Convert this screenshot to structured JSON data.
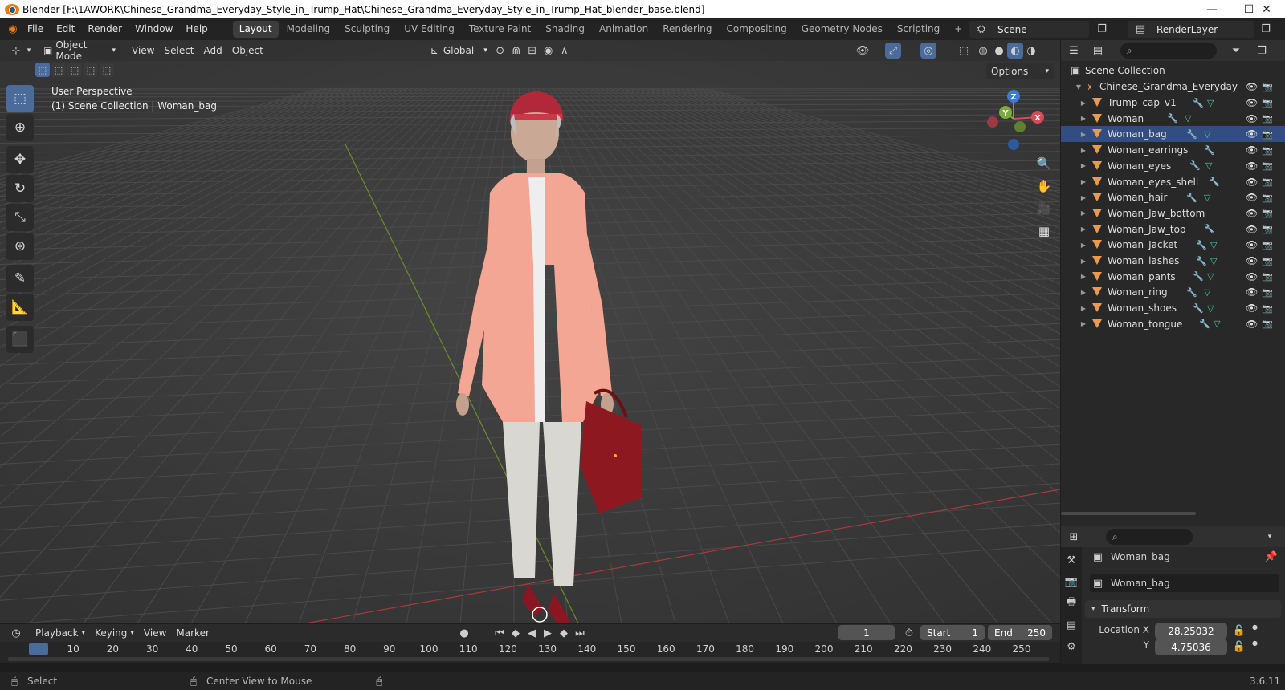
{
  "titlebar": {
    "title": "Blender [F:\\1AWORK\\Chinese_Grandma_Everyday_Style_in_Trump_Hat\\Chinese_Grandma_Everyday_Style_in_Trump_Hat_blender_base.blend]",
    "minimize": "—",
    "maximize": "☐",
    "close": "✕"
  },
  "menu": {
    "items": [
      "File",
      "Edit",
      "Render",
      "Window",
      "Help"
    ]
  },
  "workspaces": {
    "tabs": [
      "Layout",
      "Modeling",
      "Sculpting",
      "UV Editing",
      "Texture Paint",
      "Shading",
      "Animation",
      "Rendering",
      "Compositing",
      "Geometry Nodes",
      "Scripting"
    ],
    "active": "Layout",
    "add": "+"
  },
  "scene": {
    "label": "Scene",
    "render_layer": "RenderLayer"
  },
  "viewport": {
    "mode": "Object Mode",
    "menus": [
      "View",
      "Select",
      "Add",
      "Object"
    ],
    "orientation": "Global",
    "perspective": "User Perspective",
    "collection_info": "(1) Scene Collection | Woman_bag",
    "options": "Options",
    "gizmo": {
      "x": "X",
      "y": "Y",
      "z": "Z"
    }
  },
  "outliner": {
    "root": "Scene Collection",
    "collection": "Chinese_Grandma_Everyday",
    "items": [
      "Trump_cap_v1",
      "Woman",
      "Woman_bag",
      "Woman_earrings",
      "Woman_eyes",
      "Woman_eyes_shell",
      "Woman_hair",
      "Woman_Jaw_bottom",
      "Woman_Jaw_top",
      "Woman_Jacket",
      "Woman_lashes",
      "Woman_pants",
      "Woman_ring",
      "Woman_shoes",
      "Woman_tongue"
    ],
    "selected": "Woman_bag"
  },
  "properties": {
    "object_name": "Woman_bag",
    "data_name": "Woman_bag",
    "panel": "Transform",
    "location_x_label": "Location X",
    "location_x": "28.25032",
    "location_y_label": "Y",
    "location_y": "4.75036"
  },
  "timeline": {
    "menus": [
      "Playback",
      "Keying",
      "View",
      "Marker"
    ],
    "current_frame": "1",
    "start_label": "Start",
    "start": "1",
    "end_label": "End",
    "end": "250",
    "ruler": [
      "1",
      "10",
      "20",
      "30",
      "40",
      "50",
      "60",
      "70",
      "80",
      "90",
      "100",
      "110",
      "120",
      "130",
      "140",
      "150",
      "160",
      "170",
      "180",
      "190",
      "200",
      "210",
      "220",
      "230",
      "240",
      "250"
    ]
  },
  "status": {
    "select": "Select",
    "center_view": "Center View to Mouse",
    "version": "3.6.11"
  },
  "colors": {
    "accent": "#4b6b9a",
    "selection": "#334d80",
    "object_icon": "#e89a52",
    "grid_x": "#a83a3a",
    "grid_y": "#6e8c2c"
  }
}
